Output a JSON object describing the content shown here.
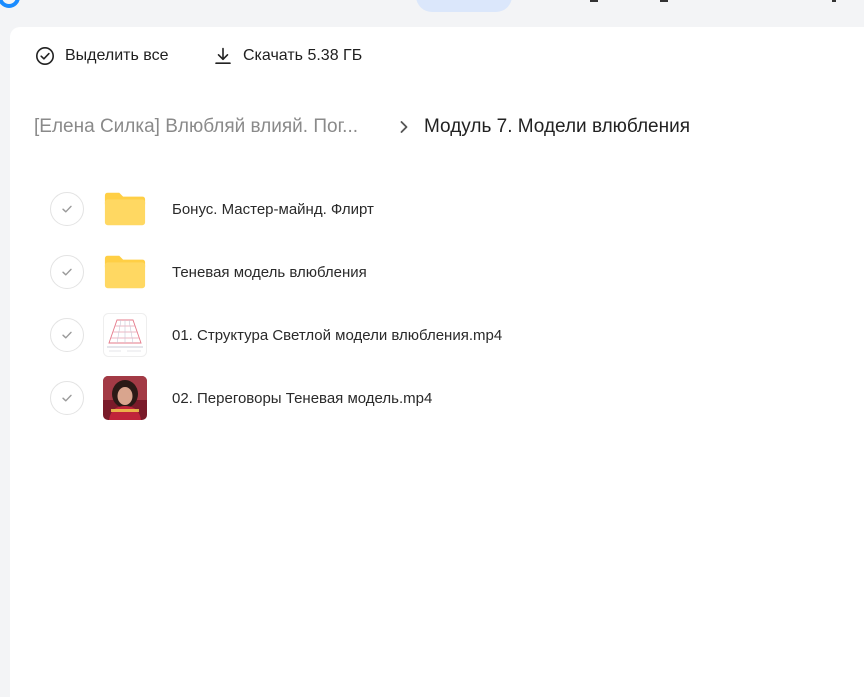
{
  "toolbar": {
    "select_all_label": "Выделить все",
    "download_label": "Скачать 5.38 ГБ"
  },
  "breadcrumb": {
    "parent": "[Елена Силка] Влюбляй влияй. Пог...",
    "current": "Модуль 7. Модели влюбления"
  },
  "files": [
    {
      "name": "Бонус. Мастер-майнд. Флирт",
      "kind": "folder-icon"
    },
    {
      "name": "Теневая модель влюбления",
      "kind": "folder-icon"
    },
    {
      "name": "01. Структура Светлой модели влюбления.mp4",
      "kind": "video-thumbnail-diagram"
    },
    {
      "name": "02. Переговоры Теневая модель.mp4",
      "kind": "video-thumbnail-portrait"
    }
  ],
  "colors": {
    "accent": "#1a8cff",
    "folder": "#ffd862",
    "folder_tab": "#ffcf45"
  }
}
